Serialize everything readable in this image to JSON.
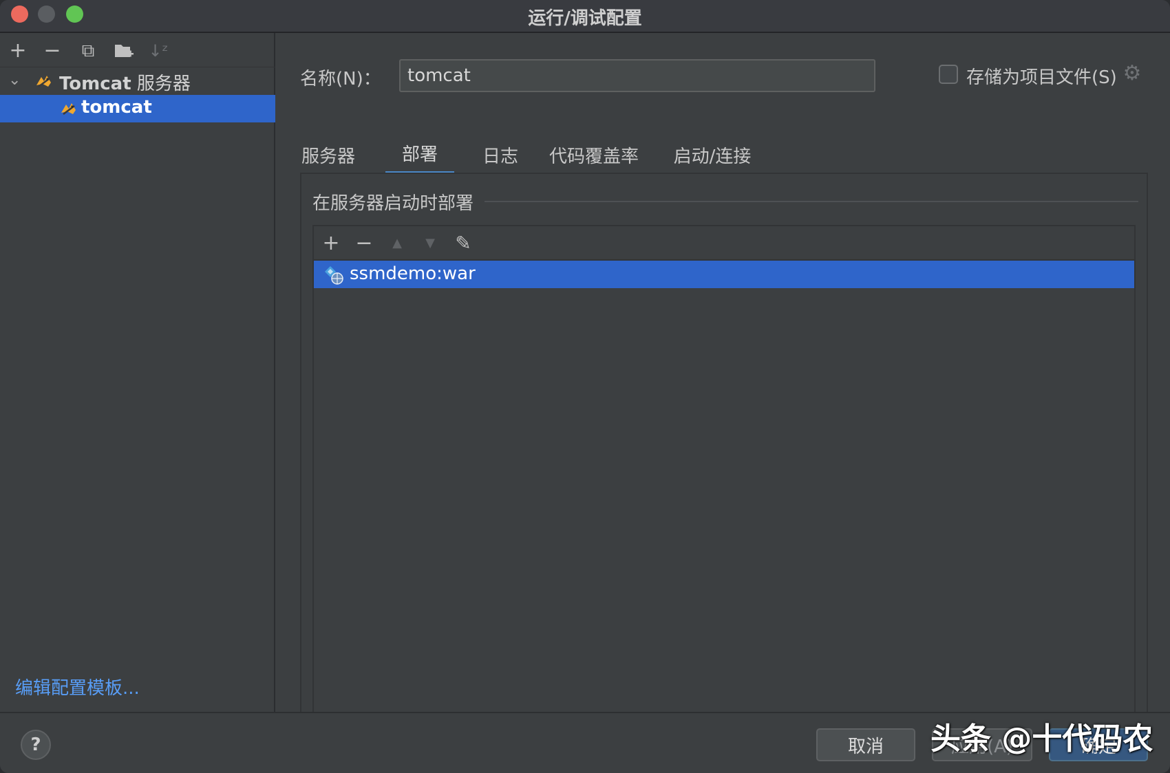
{
  "window": {
    "title": "运行/调试配置"
  },
  "sidebar": {
    "toolbar": {
      "add": "+",
      "remove": "−",
      "copy": "⧉",
      "new_folder": "▰",
      "sort": "↓ᶻ"
    },
    "group": {
      "name": "Tomcat",
      "suffix": " 服务器"
    },
    "selected_item": "tomcat",
    "edit_templates_link": "编辑配置模板..."
  },
  "main": {
    "name_label": "名称(N)：",
    "name_value": "tomcat",
    "store_as_project_file": {
      "label": "存储为项目文件(S)",
      "checked": false
    },
    "tabs": [
      {
        "label": "服务器",
        "active": false
      },
      {
        "label": "部署",
        "active": true
      },
      {
        "label": "日志",
        "active": false
      },
      {
        "label": "代码覆盖率",
        "active": false
      },
      {
        "label": "启动/连接",
        "active": false
      }
    ],
    "deploy": {
      "section_title": "在服务器启动时部署",
      "toolbar": {
        "add": "+",
        "remove": "−",
        "up": "▲",
        "down": "▼",
        "edit": "✎"
      },
      "artifacts": [
        "ssmdemo:war"
      ]
    }
  },
  "footer": {
    "help": "?",
    "cancel": "取消",
    "apply": "应用(A)",
    "ok": "确定"
  },
  "watermark": "头条 @十代码农",
  "colors": {
    "selection": "#2f65ca",
    "link": "#589df6",
    "tab_underline": "#4a88c7",
    "ok_button": "#365880"
  },
  "icons": [
    "gear-icon",
    "tomcat-cat-icon",
    "artifact-war-icon"
  ]
}
